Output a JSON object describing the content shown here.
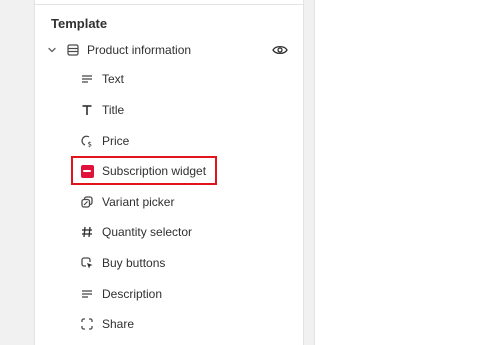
{
  "template": {
    "title": "Template",
    "group": {
      "label": "Product information",
      "items": [
        {
          "label": "Text",
          "icon": "text-lines-icon"
        },
        {
          "label": "Title",
          "icon": "title-t-icon"
        },
        {
          "label": "Price",
          "icon": "price-tag-icon"
        },
        {
          "label": "Subscription widget",
          "icon": "subscription-widget-icon",
          "highlighted": true
        },
        {
          "label": "Variant picker",
          "icon": "variant-picker-icon"
        },
        {
          "label": "Quantity selector",
          "icon": "hash-icon"
        },
        {
          "label": "Buy buttons",
          "icon": "cursor-click-icon"
        },
        {
          "label": "Description",
          "icon": "text-lines-icon"
        },
        {
          "label": "Share",
          "icon": "share-frame-icon"
        }
      ]
    }
  },
  "colors": {
    "highlight_border": "#e1131b",
    "widget_badge": "#e0113a",
    "panel_bg": "#ffffff",
    "canvas_bg": "#f1f1f1"
  }
}
